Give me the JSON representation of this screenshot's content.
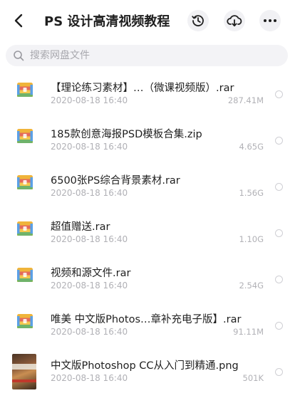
{
  "header": {
    "title": "PS 设计高清视频教程",
    "back_icon": "chevron-left-icon",
    "history_icon": "history-clock-icon",
    "cloud_icon": "cloud-download-icon",
    "more_icon": "more-dots-icon"
  },
  "search": {
    "placeholder": "搜索网盘文件",
    "value": ""
  },
  "files": [
    {
      "name": "【理论练习素材】…（微课视频版）.rar",
      "date": "2020-08-18 16:40",
      "size": "287.41M",
      "icon": "archive-file-icon"
    },
    {
      "name": "185款创意海报PSD模板合集.zip",
      "date": "2020-08-18 16:40",
      "size": "4.65G",
      "icon": "archive-file-icon"
    },
    {
      "name": "6500张PS综合背景素材.rar",
      "date": "2020-08-18 16:40",
      "size": "1.56G",
      "icon": "archive-file-icon"
    },
    {
      "name": "超值赠送.rar",
      "date": "2020-08-18 16:40",
      "size": "1.10G",
      "icon": "archive-file-icon"
    },
    {
      "name": "视频和源文件.rar",
      "date": "2020-08-18 16:40",
      "size": "2.54G",
      "icon": "archive-file-icon"
    },
    {
      "name": "唯美 中文版Photos…章补充电子版】.rar",
      "date": "2020-08-18 16:40",
      "size": "91.11M",
      "icon": "archive-file-icon"
    },
    {
      "name": "中文版Photoshop CC从入门到精通.png",
      "date": "2020-08-18 16:40",
      "size": "501K",
      "icon": "image-thumbnail"
    }
  ],
  "colors": {
    "archive_top": "#f0b43a",
    "archive_mid": "#e56a5a",
    "archive_bottom": "#6fb36a",
    "archive_side": "#5aa0e6"
  }
}
